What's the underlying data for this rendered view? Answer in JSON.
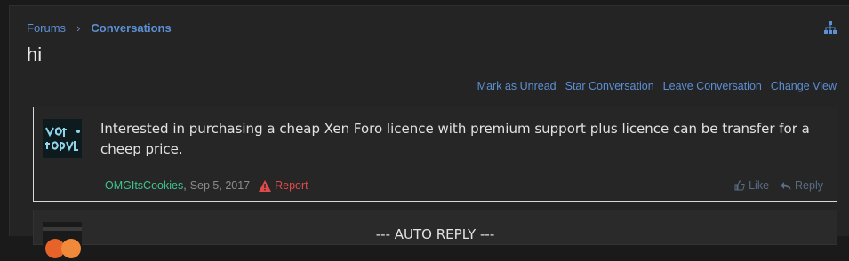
{
  "breadcrumb": {
    "items": [
      {
        "label": "Forums"
      },
      {
        "label": "Conversations"
      }
    ]
  },
  "page": {
    "title": "hi"
  },
  "actions": {
    "mark_unread": "Mark as Unread",
    "star": "Star Conversation",
    "leave": "Leave Conversation",
    "change_view": "Change View"
  },
  "message": {
    "body": "Interested in purchasing a cheap Xen Foro licence with premium support plus licence can be transfer for a cheep price.",
    "author": "OMGItsCookies",
    "separator": ",",
    "date": "Sep 5, 2017",
    "report_label": "Report",
    "like_label": "Like",
    "reply_label": "Reply"
  },
  "message2": {
    "body": "--- AUTO REPLY ---"
  },
  "colors": {
    "link": "#5c8fd4",
    "author": "#3fc48e",
    "report": "#e04a4a",
    "background": "#242424"
  },
  "icons": {
    "sitemap": "sitemap-icon",
    "report": "warning-icon",
    "like": "thumbs-up-icon",
    "reply": "reply-icon"
  }
}
